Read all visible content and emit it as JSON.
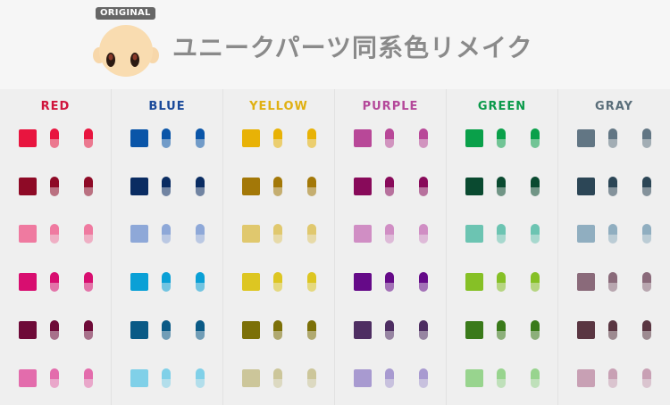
{
  "header": {
    "badge": "ORIGINAL",
    "title": "ユニークパーツ同系色リメイク"
  },
  "columns": [
    {
      "name": "RED",
      "color": "#d0143c",
      "swatches": [
        "#e8153f",
        "#8e0a26",
        "#ef7aa0",
        "#d80e70",
        "#6e0a38",
        "#e36cac"
      ]
    },
    {
      "name": "BLUE",
      "color": "#1a4a9a",
      "swatches": [
        "#0a55a8",
        "#0a2c62",
        "#8ea8d8",
        "#0aa0d6",
        "#0a5a86",
        "#80d0e8"
      ]
    },
    {
      "name": "YELLOW",
      "color": "#e0b012",
      "swatches": [
        "#e8b206",
        "#a37808",
        "#e0c86e",
        "#ddc622",
        "#7c7008",
        "#ccc69a"
      ]
    },
    {
      "name": "PURPLE",
      "color": "#b4489a",
      "swatches": [
        "#b84898",
        "#880a5a",
        "#d08ec4",
        "#650a88",
        "#4e2e62",
        "#a89ad0"
      ]
    },
    {
      "name": "GREEN",
      "color": "#0a9a4a",
      "swatches": [
        "#0aa04a",
        "#0a4a30",
        "#6cc4b2",
        "#86c026",
        "#3a7a1a",
        "#98d48e"
      ]
    },
    {
      "name": "GRAY",
      "color": "#5a6e7a",
      "swatches": [
        "#627684",
        "#2c4656",
        "#90aec0",
        "#8a6a7a",
        "#5a3642",
        "#c8a0b4"
      ]
    }
  ]
}
